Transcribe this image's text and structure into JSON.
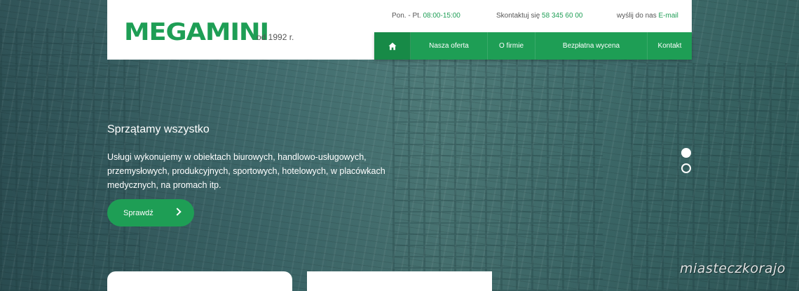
{
  "brand": {
    "logo_text": "MEGAMINI",
    "since": "od 1992 r."
  },
  "topbar": {
    "hours_label": "Pon. - Pt.",
    "hours_value": "08:00-15:00",
    "contact_label": "Skontaktuj się",
    "contact_phone": "58 345 60 00",
    "email_label": "wyślij do nas",
    "email_link": "E-mail"
  },
  "nav": {
    "home_icon": "home-icon",
    "items": [
      {
        "label": "Nasza oferta"
      },
      {
        "label": "O firmie"
      },
      {
        "label": "Bezpłatna wycena"
      },
      {
        "label": "Kontakt"
      }
    ]
  },
  "hero": {
    "title": "Sprzątamy wszystko",
    "description": "Usługi wykonujemy w obiektach biurowych, handlowo-usługowych, przemysłowych, produkcyjnych, sportowych, hotelowych, w placówkach medycznych, na promach itp.",
    "cta_label": "Sprawdź",
    "slides_active": 1
  },
  "watermark": "miasteczkorajo",
  "colors": {
    "accent": "#1e9e55",
    "accent_dark": "#178a47"
  }
}
